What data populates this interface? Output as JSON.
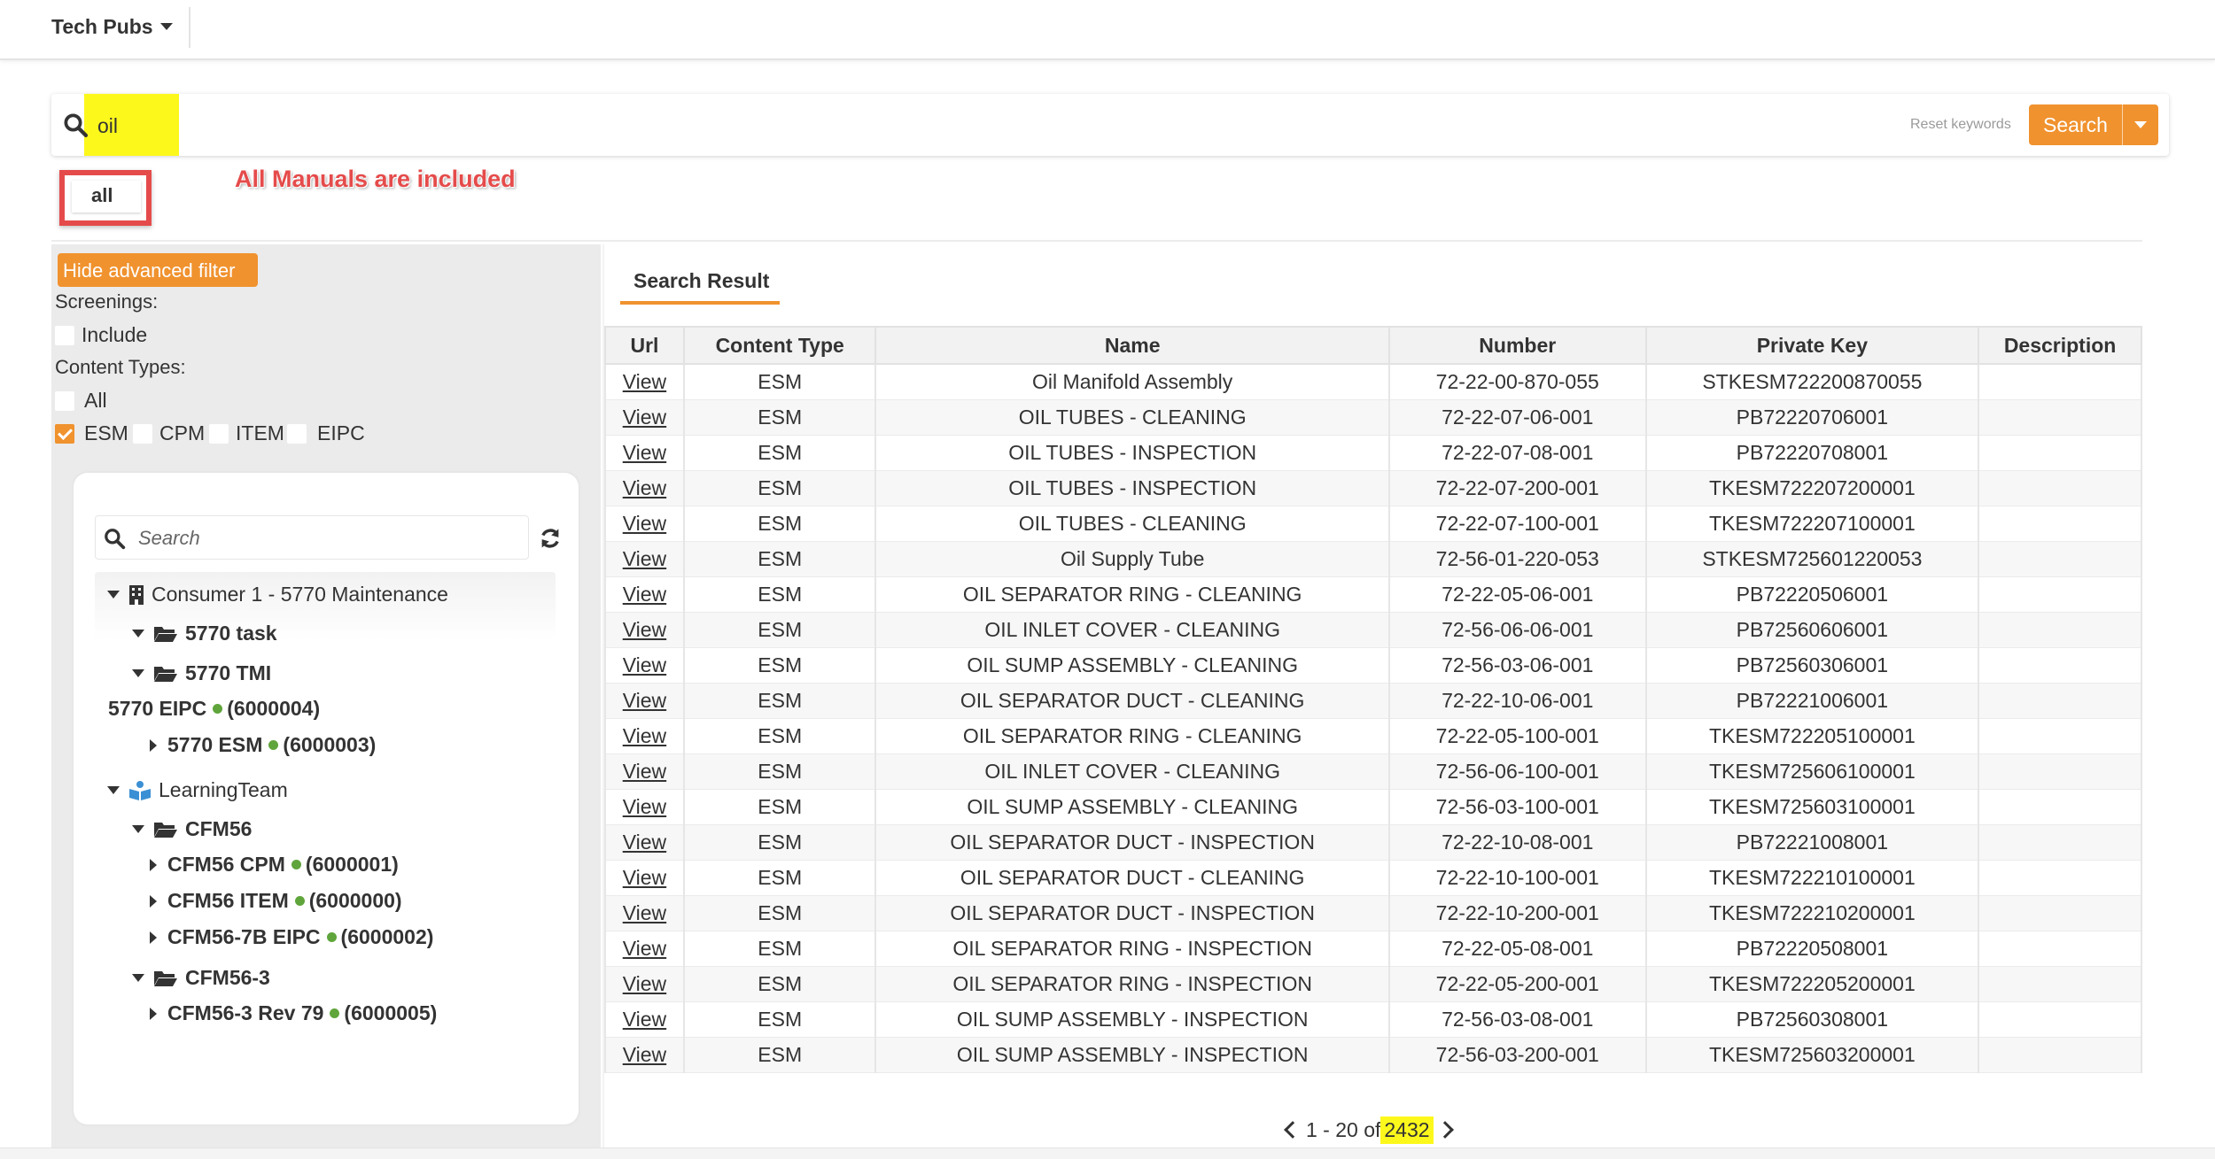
{
  "topbar": {
    "app_title": "Tech Pubs"
  },
  "search": {
    "keyword": "oil",
    "reset_label": "Reset keywords",
    "button_label": "Search"
  },
  "scope_chip": {
    "label": "all"
  },
  "annotation": {
    "text": "All Manuals are included"
  },
  "filter": {
    "hide_button": "Hide advanced filter",
    "screenings_label": "Screenings:",
    "include_label": "Include",
    "include_checked": false,
    "content_types_label": "Content Types:",
    "all_label": "All",
    "types": [
      {
        "label": "ESM",
        "checked": true
      },
      {
        "label": "CPM",
        "checked": false
      },
      {
        "label": "ITEM",
        "checked": false
      },
      {
        "label": "EIPC",
        "checked": false
      }
    ]
  },
  "tree": {
    "search_placeholder": "Search",
    "nodes": {
      "consumer": "Consumer 1 - 5770 Maintenance",
      "task5770": "5770 task",
      "tmi5770": "5770 TMI",
      "eipc5770": "5770 EIPC",
      "eipc5770_id": "(6000004)",
      "esm5770": "5770 ESM",
      "esm5770_id": "(6000003)",
      "learning": "LearningTeam",
      "cfm56": "CFM56",
      "cfm56_cpm": "CFM56 CPM",
      "cfm56_cpm_id": "(6000001)",
      "cfm56_item": "CFM56 ITEM",
      "cfm56_item_id": "(6000000)",
      "cfm56_7b": "CFM56-7B EIPC",
      "cfm56_7b_id": "(6000002)",
      "cfm56_3": "CFM56-3",
      "cfm56_3_rev": "CFM56-3 Rev 79",
      "cfm56_3_rev_id": "(6000005)"
    }
  },
  "results": {
    "tab_label": "Search Result",
    "columns": [
      "Url",
      "Content Type",
      "Name",
      "Number",
      "Private Key",
      "Description"
    ],
    "view_label": "View",
    "rows": [
      [
        "ESM",
        "Oil Manifold Assembly",
        "72-22-00-870-055",
        "STKESM722200870055",
        ""
      ],
      [
        "ESM",
        "OIL TUBES - CLEANING",
        "72-22-07-06-001",
        "PB72220706001",
        ""
      ],
      [
        "ESM",
        "OIL TUBES - INSPECTION",
        "72-22-07-08-001",
        "PB72220708001",
        ""
      ],
      [
        "ESM",
        "OIL TUBES - INSPECTION",
        "72-22-07-200-001",
        "TKESM722207200001",
        ""
      ],
      [
        "ESM",
        "OIL TUBES - CLEANING",
        "72-22-07-100-001",
        "TKESM722207100001",
        ""
      ],
      [
        "ESM",
        "Oil Supply Tube",
        "72-56-01-220-053",
        "STKESM725601220053",
        ""
      ],
      [
        "ESM",
        "OIL SEPARATOR RING - CLEANING",
        "72-22-05-06-001",
        "PB72220506001",
        ""
      ],
      [
        "ESM",
        "OIL INLET COVER - CLEANING",
        "72-56-06-06-001",
        "PB72560606001",
        ""
      ],
      [
        "ESM",
        "OIL SUMP ASSEMBLY - CLEANING",
        "72-56-03-06-001",
        "PB72560306001",
        ""
      ],
      [
        "ESM",
        "OIL SEPARATOR DUCT - CLEANING",
        "72-22-10-06-001",
        "PB72221006001",
        ""
      ],
      [
        "ESM",
        "OIL SEPARATOR RING - CLEANING",
        "72-22-05-100-001",
        "TKESM722205100001",
        ""
      ],
      [
        "ESM",
        "OIL INLET COVER - CLEANING",
        "72-56-06-100-001",
        "TKESM725606100001",
        ""
      ],
      [
        "ESM",
        "OIL SUMP ASSEMBLY - CLEANING",
        "72-56-03-100-001",
        "TKESM725603100001",
        ""
      ],
      [
        "ESM",
        "OIL SEPARATOR DUCT - INSPECTION",
        "72-22-10-08-001",
        "PB72221008001",
        ""
      ],
      [
        "ESM",
        "OIL SEPARATOR DUCT - CLEANING",
        "72-22-10-100-001",
        "TKESM722210100001",
        ""
      ],
      [
        "ESM",
        "OIL SEPARATOR DUCT - INSPECTION",
        "72-22-10-200-001",
        "TKESM722210200001",
        ""
      ],
      [
        "ESM",
        "OIL SEPARATOR RING - INSPECTION",
        "72-22-05-08-001",
        "PB72220508001",
        ""
      ],
      [
        "ESM",
        "OIL SEPARATOR RING - INSPECTION",
        "72-22-05-200-001",
        "TKESM722205200001",
        ""
      ],
      [
        "ESM",
        "OIL SUMP ASSEMBLY - INSPECTION",
        "72-56-03-08-001",
        "PB72560308001",
        ""
      ],
      [
        "ESM",
        "OIL SUMP ASSEMBLY - INSPECTION",
        "72-56-03-200-001",
        "TKESM725603200001",
        ""
      ]
    ]
  },
  "pagination": {
    "range": "1 - 20 of",
    "total": "2432"
  },
  "colors": {
    "accent": "#f0922e",
    "highlight": "#fdf81c",
    "annotation": "#e54b4b",
    "status_dot": "#5fa53b"
  }
}
